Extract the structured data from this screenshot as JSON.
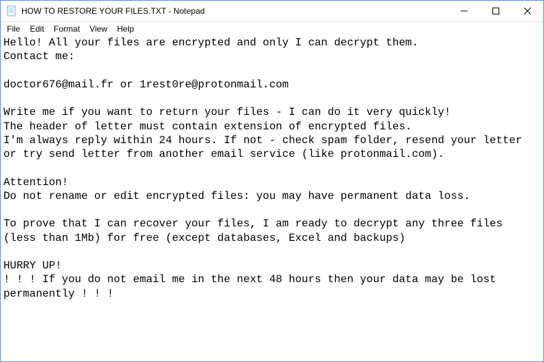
{
  "window": {
    "title": "HOW TO RESTORE YOUR FILES.TXT - Notepad"
  },
  "menu": {
    "file": "File",
    "edit": "Edit",
    "format": "Format",
    "view": "View",
    "help": "Help"
  },
  "content": {
    "text": "Hello! All your files are encrypted and only I can decrypt them.\nContact me:\n\ndoctor676@mail.fr or 1rest0re@protonmail.com\n\nWrite me if you want to return your files - I can do it very quickly!\nThe header of letter must contain extension of encrypted files.\nI'm always reply within 24 hours. If not - check spam folder, resend your letter or try send letter from another email service (like protonmail.com).\n\nAttention!\nDo not rename or edit encrypted files: you may have permanent data loss.\n\nTo prove that I can recover your files, I am ready to decrypt any three files (less than 1Mb) for free (except databases, Excel and backups)\n\nHURRY UP!\n! ! ! If you do not email me in the next 48 hours then your data may be lost permanently ! ! !"
  }
}
